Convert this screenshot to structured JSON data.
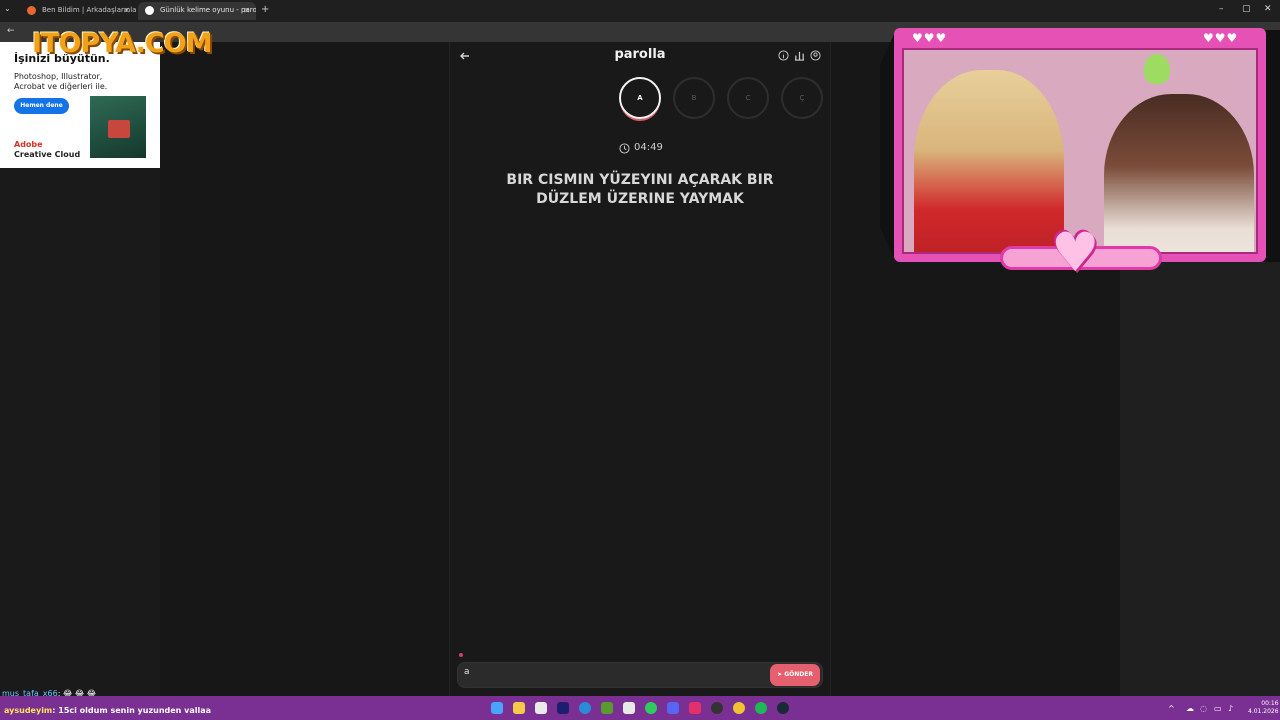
{
  "browser": {
    "tabs": [
      {
        "label": "Ben Bildim | Arkadaşlarınla Onli",
        "active": false
      },
      {
        "label": "Günlük kelime oyunu - parolla",
        "active": true
      }
    ],
    "new_tab": "+",
    "window_controls": [
      "–",
      "▢",
      "✕"
    ]
  },
  "ad": {
    "watermark": "ITOPYA.COM",
    "headline": "İşinizi büyütün.",
    "body": "Photoshop, Illustrator, Acrobat ve diğerleri ile.",
    "cta": "Hemen dene",
    "brand_line1": "Adobe",
    "brand_line2": "Creative Cloud",
    "colors": {
      "cta": "#1473e6",
      "brand": "#d5332a",
      "watermark": "#f2a21a"
    }
  },
  "game": {
    "title": "parolla",
    "letters": [
      {
        "letter": "A",
        "active": true
      },
      {
        "letter": "B",
        "active": false
      },
      {
        "letter": "C",
        "active": false
      },
      {
        "letter": "Ç",
        "active": false
      }
    ],
    "timer": "04:49",
    "clue": "BIR CISMIN YÜZEYINI AÇARAK BIR DÜZLEM ÜZERINE YAYMAK",
    "answer_value": "a",
    "send_label": "GÖNDER",
    "icons": [
      "back-arrow-icon",
      "info-icon",
      "stats-icon",
      "profile-icon",
      "clock-icon",
      "send-icon"
    ],
    "colors": {
      "accent": "#e55f6f",
      "background": "#191919"
    }
  },
  "stream": {
    "hearts_left": "♥♥♥",
    "hearts_right": "♥♥♥",
    "center_heart": "♥",
    "colors": {
      "frame": "#e651b6",
      "bar": "#f6a2d5"
    }
  },
  "chat": {
    "line1": {
      "user": "mus_tafa_x66",
      "message": ": 😂 😂 😂"
    },
    "line2": {
      "user": "aysudeyim",
      "message": ": 15ci oldum senin yuzunden vallaa"
    }
  },
  "taskbar": {
    "time": "00:16",
    "date": "4.01.2026",
    "tray_chevron": "^"
  }
}
